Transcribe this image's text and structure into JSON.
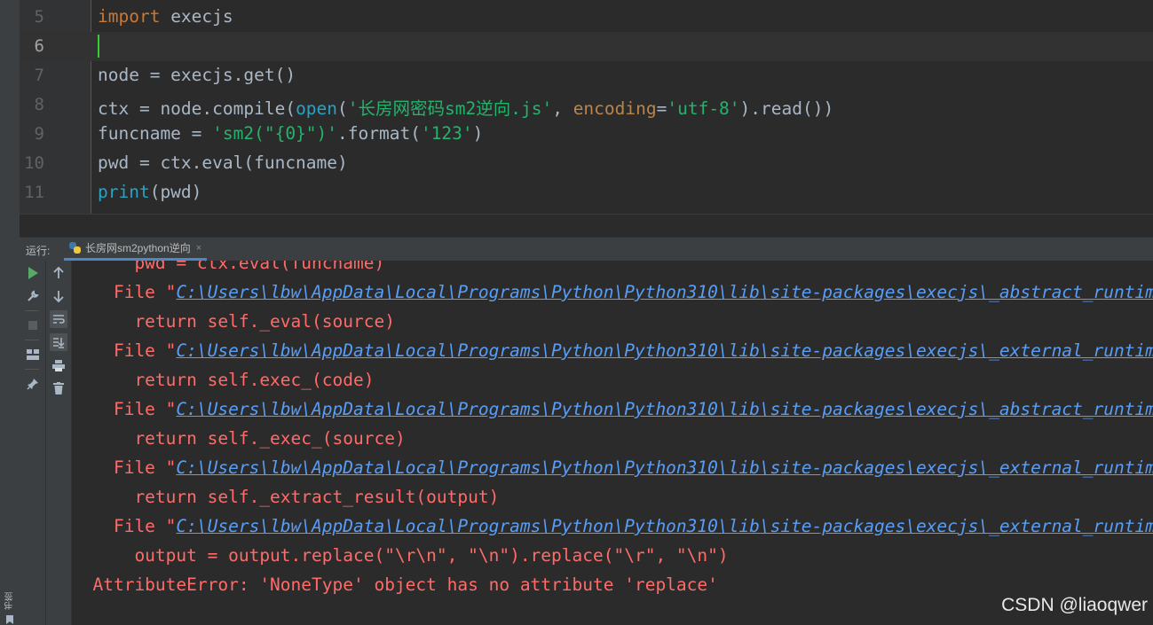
{
  "editor": {
    "lines": [
      {
        "no": "5",
        "parts": [
          {
            "t": "import",
            "c": "kw"
          },
          {
            "t": " execjs",
            "c": ""
          }
        ]
      },
      {
        "no": "6",
        "parts": [],
        "current": true
      },
      {
        "no": "7",
        "parts": [
          {
            "t": "node = execjs.get()",
            "c": ""
          }
        ]
      },
      {
        "no": "8",
        "parts": [
          {
            "t": "ctx = node.compile(",
            "c": ""
          },
          {
            "t": "open",
            "c": "bi"
          },
          {
            "t": "(",
            "c": ""
          },
          {
            "t": "'长房网密码sm2逆向.js'",
            "c": "str"
          },
          {
            "t": ", ",
            "c": ""
          },
          {
            "t": "encoding",
            "c": "par"
          },
          {
            "t": "=",
            "c": ""
          },
          {
            "t": "'utf-8'",
            "c": "str"
          },
          {
            "t": ").read())",
            "c": ""
          }
        ]
      },
      {
        "no": "9",
        "parts": [
          {
            "t": "funcname = ",
            "c": ""
          },
          {
            "t": "'sm2(\"{0}\")'",
            "c": "str"
          },
          {
            "t": ".format(",
            "c": ""
          },
          {
            "t": "'123'",
            "c": "str"
          },
          {
            "t": ")",
            "c": ""
          }
        ]
      },
      {
        "no": "10",
        "parts": [
          {
            "t": "pwd = ctx.eval(funcname)",
            "c": ""
          }
        ]
      },
      {
        "no": "11",
        "parts": [
          {
            "t": "print",
            "c": "bi"
          },
          {
            "t": "(pwd)",
            "c": ""
          }
        ]
      }
    ]
  },
  "run_panel": {
    "label": "运行:",
    "tab_title": "长房网sm2python逆向",
    "tab_close": "×"
  },
  "console": {
    "lines": [
      {
        "indent": "    ",
        "text": "pwd = ctx.eval(funcname)"
      },
      {
        "indent": "  ",
        "prefix": "File \"",
        "link": "C:\\Users\\lbw\\AppData\\Local\\Programs\\Python\\Python310\\lib\\site-packages\\execjs\\_abstract_runtime.py"
      },
      {
        "indent": "    ",
        "text": "return self._eval(source)"
      },
      {
        "indent": "  ",
        "prefix": "File \"",
        "link": "C:\\Users\\lbw\\AppData\\Local\\Programs\\Python\\Python310\\lib\\site-packages\\execjs\\_external_runtime.py"
      },
      {
        "indent": "    ",
        "text": "return self.exec_(code)"
      },
      {
        "indent": "  ",
        "prefix": "File \"",
        "link": "C:\\Users\\lbw\\AppData\\Local\\Programs\\Python\\Python310\\lib\\site-packages\\execjs\\_abstract_runtime.py"
      },
      {
        "indent": "    ",
        "text": "return self._exec_(source)"
      },
      {
        "indent": "  ",
        "prefix": "File \"",
        "link": "C:\\Users\\lbw\\AppData\\Local\\Programs\\Python\\Python310\\lib\\site-packages\\execjs\\_external_runtime.py"
      },
      {
        "indent": "    ",
        "text": "return self._extract_result(output)"
      },
      {
        "indent": "  ",
        "prefix": "File \"",
        "link": "C:\\Users\\lbw\\AppData\\Local\\Programs\\Python\\Python310\\lib\\site-packages\\execjs\\_external_runtime.py"
      },
      {
        "indent": "    ",
        "text": "output = output.replace(\"\\r\\n\", \"\\n\").replace(\"\\r\", \"\\n\")"
      },
      {
        "indent": "",
        "text": "AttributeError: 'NoneType' object has no attribute 'replace'"
      }
    ]
  },
  "watermark": "CSDN @liaoqwer",
  "left_strip_label": "书签",
  "colors": {
    "keyword": "#cc7832",
    "builtin": "#26a3c6",
    "string": "#24b36b",
    "param": "#b8854b",
    "error_text": "#ff6b68",
    "link": "#5c9be6",
    "caret": "#33cc33",
    "tab_underline": "#4a88c7"
  },
  "icons": {
    "toolbar1": [
      "rerun-icon",
      "wrench-icon",
      "stop-icon",
      "layout-icon",
      "pin-icon"
    ],
    "toolbar2": [
      "arrow-up-icon",
      "arrow-down-icon",
      "soft-wrap-icon",
      "scroll-to-end-icon",
      "print-icon",
      "trash-icon"
    ]
  }
}
